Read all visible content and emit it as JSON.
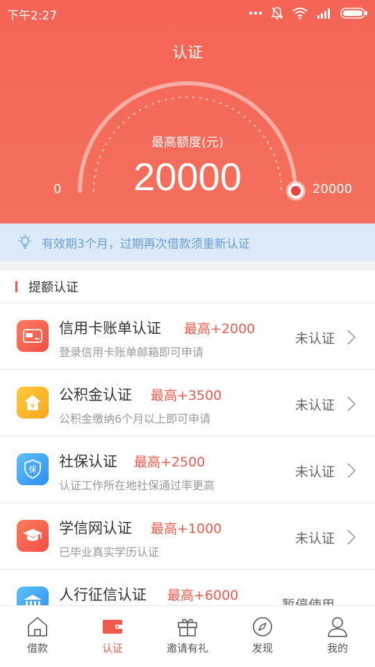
{
  "status_bar": {
    "time": "下午2:27"
  },
  "header": {
    "title": "认证"
  },
  "gauge": {
    "caption": "最高额度(元)",
    "value": "20000",
    "min_label": "0",
    "max_label": "20000",
    "level_fraction": 1.0
  },
  "notice": {
    "text": "有效期3个月，过期再次借款须重新认证"
  },
  "section": {
    "title": "提额认证"
  },
  "items": [
    {
      "title": "信用卡账单认证",
      "bonus": "最高+2000",
      "desc": "登录信用卡账单邮箱即可申请",
      "status": "未认证",
      "icon": "credit-card-icon",
      "color": "#f46552"
    },
    {
      "title": "公积金认证",
      "bonus": "最高+3500",
      "desc": "公积金缴纳6个月以上即可申请",
      "status": "未认证",
      "icon": "house-yuan-icon",
      "color": "#fdb92b"
    },
    {
      "title": "社保认证",
      "bonus": "最高+2500",
      "desc": "认证工作所在地社保通过率更高",
      "status": "未认证",
      "icon": "shield-icon",
      "color": "#3aa5f2"
    },
    {
      "title": "学信网认证",
      "bonus": "最高+1000",
      "desc": "已毕业真实学历认证",
      "status": "未认证",
      "icon": "graduation-cap-icon",
      "color": "#f46552"
    },
    {
      "title": "人行征信认证",
      "bonus": "最高+6000",
      "desc": "",
      "status": "暂停使用",
      "icon": "bank-icon",
      "color": "#3aa5f2"
    }
  ],
  "tabs": [
    {
      "label": "借款",
      "icon": "home-icon"
    },
    {
      "label": "认证",
      "icon": "wallet-icon",
      "active": true
    },
    {
      "label": "邀请有礼",
      "icon": "gift-icon"
    },
    {
      "label": "发现",
      "icon": "compass-icon"
    },
    {
      "label": "我的",
      "icon": "person-icon"
    }
  ],
  "colors": {
    "brand": "#f4705c",
    "accent_text": "#ee5a4b",
    "notice_bg": "#dceaf8",
    "notice_text": "#6a9fd6"
  }
}
